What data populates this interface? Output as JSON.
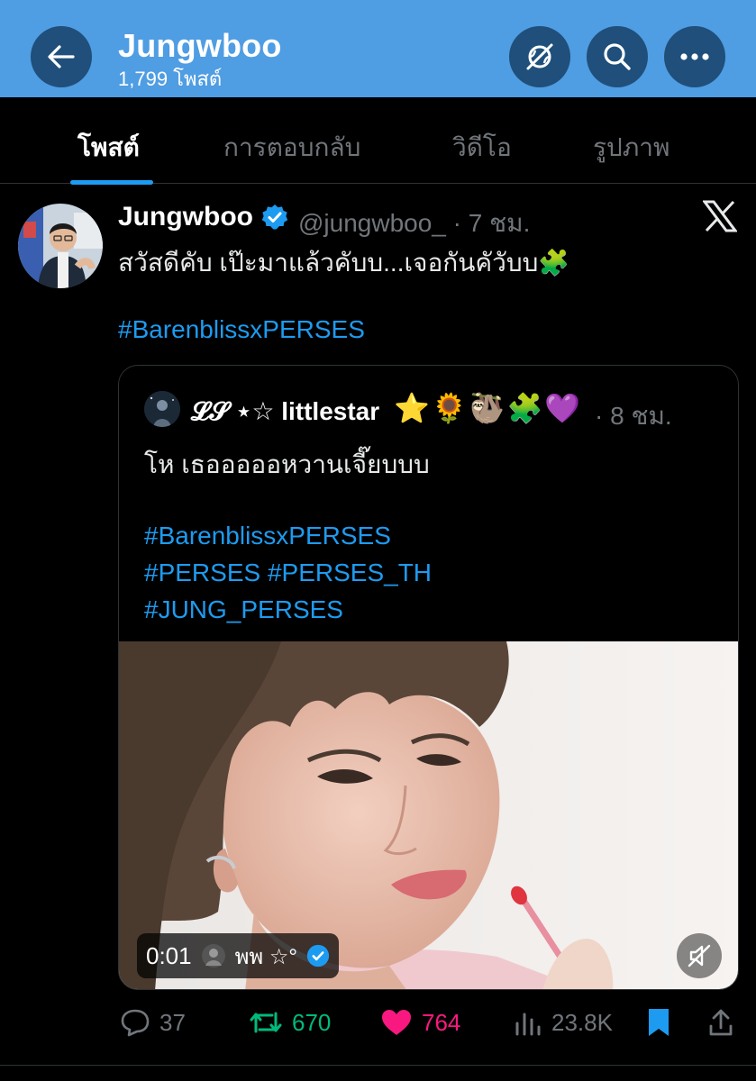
{
  "header": {
    "title": "Jungwboo",
    "subtitle": "1,799 โพสต์",
    "back_icon": "arrow-left-icon",
    "buttons": [
      "translate-off-icon",
      "search-icon",
      "more-icon"
    ],
    "accent": "#4f9de3"
  },
  "tabs": [
    {
      "label": "โพสต์",
      "active": true
    },
    {
      "label": "การตอบกลับ",
      "active": false
    },
    {
      "label": "วิดีโอ",
      "active": false
    },
    {
      "label": "รูปภาพ",
      "active": false
    }
  ],
  "post": {
    "author_name": "Jungwboo",
    "author_handle": "@jungwboo_",
    "time": "· 7 ชม.",
    "text": "สวัสดีคับ เป๊ะมาแล้วคับบ...เจอกันคัวับบ🧩",
    "hashtag": "#BarenblissxPERSES",
    "quote": {
      "name": "𝓛𝓢 ⋆☆ littlestar",
      "emojis": "⭐🌻🦥🧩💜",
      "time": "· 8 ชม.",
      "text": "โห เธอออออหวานเจี๊ยบบบ",
      "hashtags": [
        "#BarenblissxPERSES",
        "#PERSES #PERSES_TH",
        "#JUNG_PERSES"
      ],
      "video": {
        "time": "0:01",
        "user": "พพ ☆°"
      }
    },
    "stats": {
      "replies": "37",
      "reposts": "670",
      "likes": "764",
      "views": "23.8K"
    }
  },
  "colors": {
    "link": "#1d9bf0",
    "repost": "#00ba7c",
    "like": "#f91880",
    "muted": "#71767b"
  }
}
